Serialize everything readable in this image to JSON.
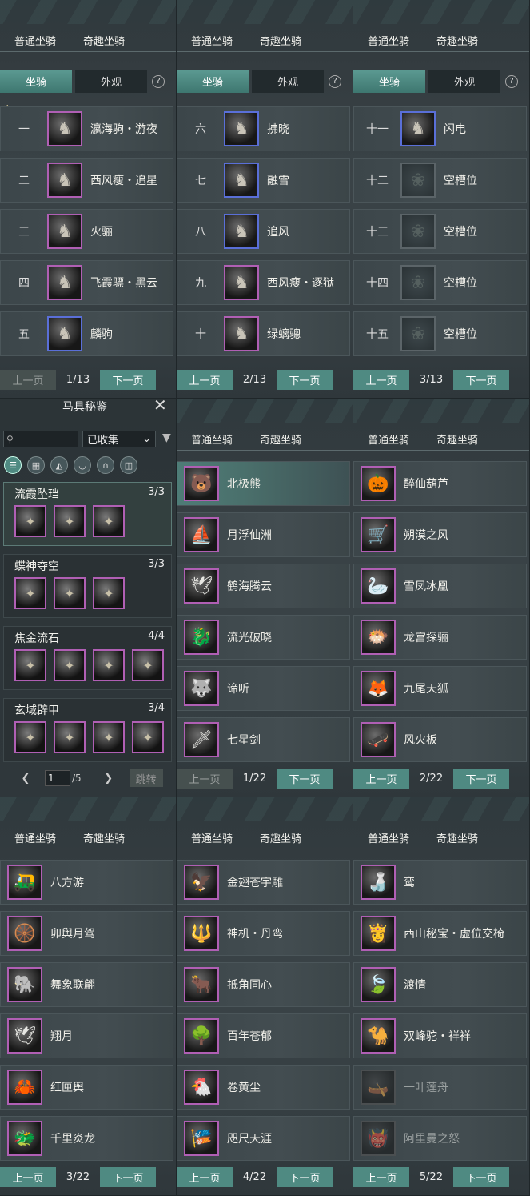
{
  "tabs": {
    "normal": "普通坐骑",
    "fun": "奇趣坐骑"
  },
  "segment": {
    "mount": "坐骑",
    "look": "外观",
    "help": "?"
  },
  "pager": {
    "prev": "上一页",
    "next": "下一页"
  },
  "mountPanels": [
    {
      "page": "1/13",
      "rows": [
        {
          "num": "一",
          "name": "瀛海驹・游夜",
          "icon": "horse-icon",
          "frame": "purple"
        },
        {
          "num": "二",
          "name": "西风瘦・追星",
          "icon": "horse-icon",
          "frame": "purple"
        },
        {
          "num": "三",
          "name": "火骊",
          "icon": "horse-icon",
          "frame": "purple"
        },
        {
          "num": "四",
          "name": "飞霞骠・黑云",
          "icon": "horse-icon",
          "frame": "purple"
        },
        {
          "num": "五",
          "name": "麟驹",
          "icon": "horse-icon",
          "frame": "blue"
        }
      ]
    },
    {
      "page": "2/13",
      "rows": [
        {
          "num": "六",
          "name": "拂晓",
          "icon": "horse-icon",
          "frame": "blue"
        },
        {
          "num": "七",
          "name": "融雪",
          "icon": "horse-icon",
          "frame": "blue"
        },
        {
          "num": "八",
          "name": "追风",
          "icon": "horse-icon",
          "frame": "blue"
        },
        {
          "num": "九",
          "name": "西风瘦・逐狱",
          "icon": "horse-icon",
          "frame": "purple"
        },
        {
          "num": "十",
          "name": "绿螭骢",
          "icon": "horse-icon",
          "frame": "purple"
        }
      ]
    },
    {
      "page": "3/13",
      "rows": [
        {
          "num": "十一",
          "name": "闪电",
          "icon": "horse-icon",
          "frame": "blue"
        },
        {
          "num": "十二",
          "name": "空槽位",
          "icon": "empty-slot-icon",
          "frame": "empty"
        },
        {
          "num": "十三",
          "name": "空槽位",
          "icon": "empty-slot-icon",
          "frame": "empty"
        },
        {
          "num": "十四",
          "name": "空槽位",
          "icon": "empty-slot-icon",
          "frame": "empty"
        },
        {
          "num": "十五",
          "name": "空槽位",
          "icon": "empty-slot-icon",
          "frame": "empty"
        }
      ]
    }
  ],
  "collection": {
    "title": "马具秘鉴",
    "filter": "已收集",
    "page": "1",
    "total": "/5",
    "jump": "跳转",
    "sets": [
      {
        "name": "流霞坠珰",
        "count": "3/3",
        "items": 3
      },
      {
        "name": "蝶神夺空",
        "count": "3/3",
        "items": 3
      },
      {
        "name": "焦金流石",
        "count": "4/4",
        "items": 4
      },
      {
        "name": "玄域辟甲",
        "count": "3/4",
        "items": 4
      }
    ]
  },
  "funPanels": [
    {
      "page": "1/22",
      "prevDisabled": true,
      "rows": [
        "北极熊",
        "月浮仙洲",
        "鹤海腾云",
        "流光破晓",
        "谛听",
        "七星剑"
      ]
    },
    {
      "page": "2/22",
      "prevDisabled": false,
      "rows": [
        "醉仙葫芦",
        "朔漠之风",
        "雪凤冰凰",
        "龙宫探骊",
        "九尾天狐",
        "风火板"
      ]
    },
    {
      "page": "3/22",
      "prevDisabled": false,
      "rows": [
        "八方游",
        "卯舆月驾",
        "舞象联翩",
        "翔月",
        "红匣舆",
        "千里炎龙"
      ]
    },
    {
      "page": "4/22",
      "prevDisabled": false,
      "rows": [
        "金翅苍宇雕",
        "神机・丹鸾",
        "抵角同心",
        "百年苍郁",
        "卷黄尘",
        "咫尺天涯"
      ]
    },
    {
      "page": "5/22",
      "prevDisabled": false,
      "rows": [
        "鸾",
        "西山秘宝・虚位交椅",
        "渡情",
        "双峰驼・祥祥",
        "一叶莲舟",
        "阿里曼之怒"
      ]
    }
  ]
}
